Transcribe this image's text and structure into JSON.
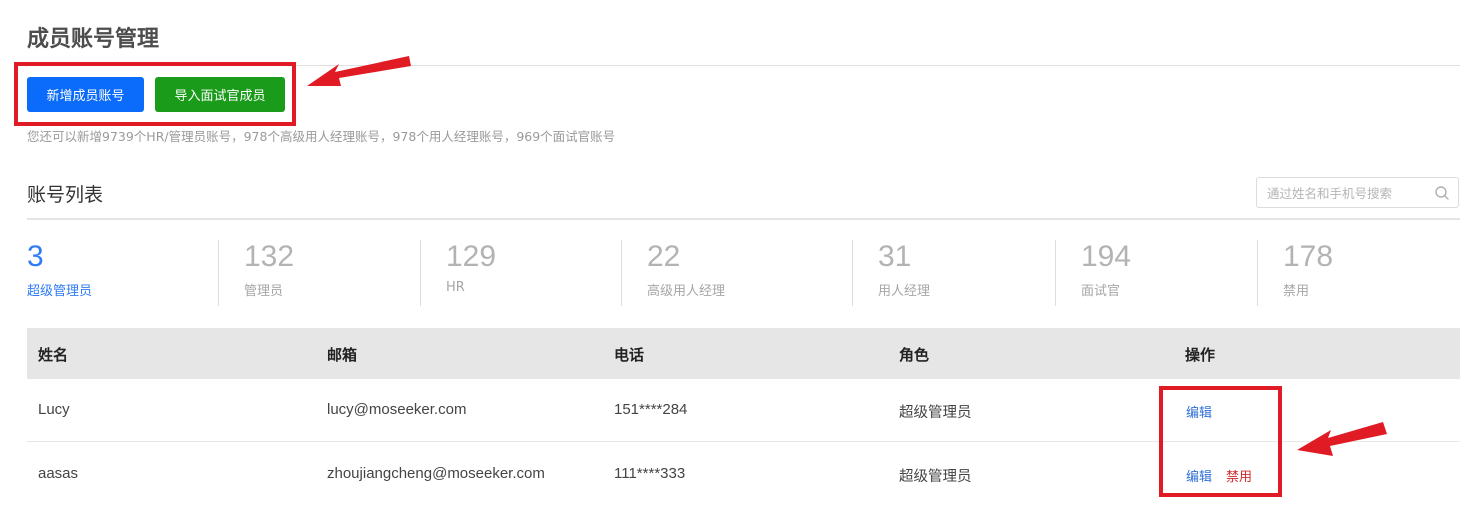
{
  "header": {
    "title": "成员账号管理",
    "add_member_button": "新增成员账号",
    "import_interviewer_button": "导入面试官成员",
    "quota_hint": "您还可以新增9739个HR/管理员账号，978个高级用人经理账号，978个用人经理账号，969个面试官账号"
  },
  "account_list": {
    "title": "账号列表",
    "search_placeholder": "通过姓名和手机号搜索"
  },
  "stats": [
    {
      "count": "3",
      "label": "超级管理员",
      "active": true
    },
    {
      "count": "132",
      "label": "管理员",
      "active": false
    },
    {
      "count": "129",
      "label": "HR",
      "active": false
    },
    {
      "count": "22",
      "label": "高级用人经理",
      "active": false
    },
    {
      "count": "31",
      "label": "用人经理",
      "active": false
    },
    {
      "count": "194",
      "label": "面试官",
      "active": false
    },
    {
      "count": "178",
      "label": "禁用",
      "active": false
    }
  ],
  "table": {
    "columns": [
      "姓名",
      "邮箱",
      "电话",
      "角色",
      "操作"
    ],
    "rows": [
      {
        "name": "Lucy",
        "email": "lucy@moseeker.com",
        "phone": "151****284",
        "role": "超级管理员",
        "actions": [
          "编辑"
        ]
      },
      {
        "name": "aasas",
        "email": "zhoujiangcheng@moseeker.com",
        "phone": "111****333",
        "role": "超级管理员",
        "actions": [
          "编辑",
          "禁用"
        ]
      }
    ]
  },
  "colors": {
    "primary_blue": "#0b6cfb",
    "primary_green": "#1a9b1a",
    "active_stat": "#2f7cf6",
    "edit_link": "#2f6fd8",
    "disable_link": "#d22a2a",
    "annotation_red": "#e01b24"
  },
  "icons": {
    "search": "search-icon"
  }
}
